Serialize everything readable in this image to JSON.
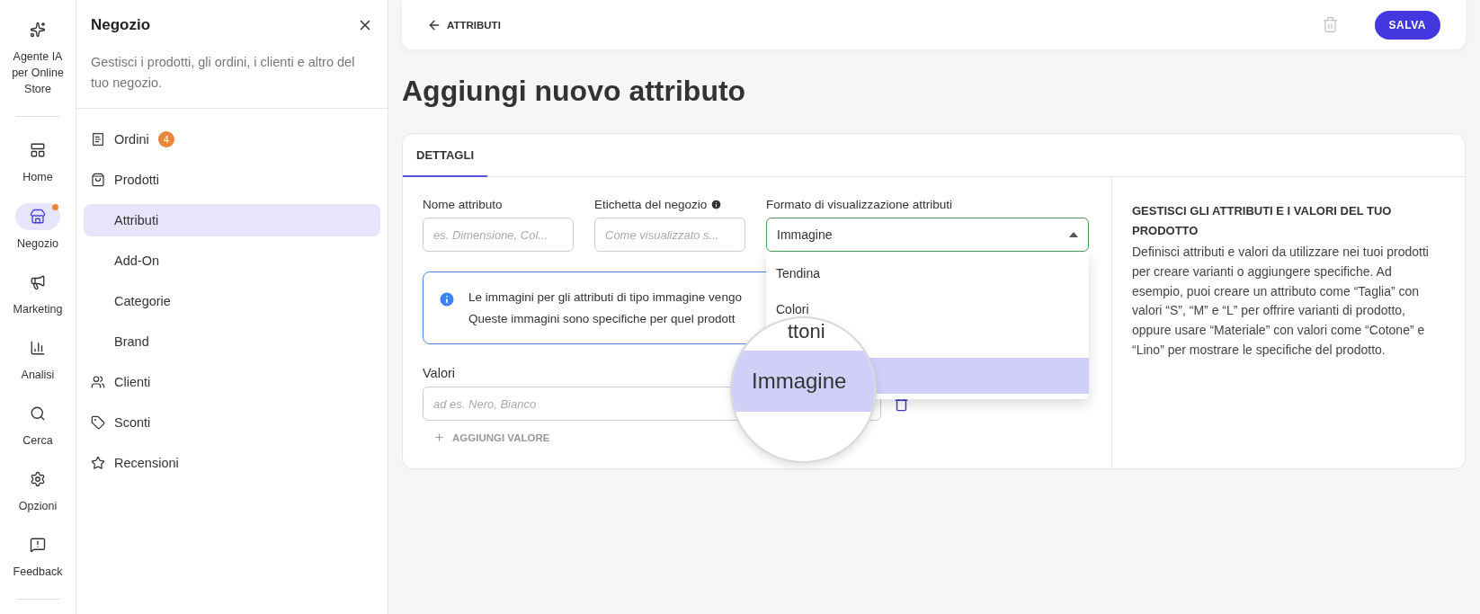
{
  "rail": {
    "items": [
      {
        "label": "Agente IA per Online Store",
        "kind": "assistant",
        "selected": false,
        "notification": false
      },
      {
        "label": "Home",
        "kind": "home",
        "selected": false,
        "notification": false
      },
      {
        "label": "Negozio",
        "kind": "store",
        "selected": true,
        "notification": true
      },
      {
        "label": "Marketing",
        "kind": "marketing",
        "selected": false,
        "notification": false
      },
      {
        "label": "Analisi",
        "kind": "analytics",
        "selected": false,
        "notification": false
      }
    ],
    "bottom_items": [
      {
        "label": "Cerca",
        "kind": "search",
        "selected": false,
        "notification": false
      },
      {
        "label": "Opzioni",
        "kind": "settings",
        "selected": false,
        "notification": false
      },
      {
        "label": "Feedback",
        "kind": "feedback",
        "selected": false,
        "notification": false
      }
    ]
  },
  "sidebar": {
    "title": "Negozio",
    "description": "Gestisci i prodotti, gli ordini, i clienti e altro del tuo negozio.",
    "items": [
      {
        "label": "Ordini",
        "kind": "orders",
        "badge": "4",
        "selected": false
      },
      {
        "label": "Prodotti",
        "kind": "products",
        "selected": false,
        "children": [
          {
            "label": "Attributi",
            "selected": true
          },
          {
            "label": "Add-On",
            "selected": false
          },
          {
            "label": "Categorie",
            "selected": false
          },
          {
            "label": "Brand",
            "selected": false
          }
        ]
      },
      {
        "label": "Clienti",
        "kind": "customers",
        "selected": false
      },
      {
        "label": "Sconti",
        "kind": "discounts",
        "selected": false
      },
      {
        "label": "Recensioni",
        "kind": "reviews",
        "selected": false
      }
    ]
  },
  "topbar": {
    "back": "ATTRIBUTI",
    "save": "SALVA"
  },
  "page": {
    "title": "Aggiungi nuovo attributo"
  },
  "card": {
    "tabs": [
      {
        "label": "DETTAGLI",
        "selected": true
      }
    ],
    "fields": [
      {
        "label": "Nome attributo",
        "info": false,
        "placeholder": "es. Dimensione, Col..."
      },
      {
        "label": "Etichetta del negozio",
        "info": true,
        "placeholder": "Come visualizzato s..."
      }
    ],
    "format": {
      "label": "Formato di visualizzazione attributi",
      "value": "Immagine",
      "expanded": true,
      "options": [
        {
          "label": "Tendina",
          "selected": false
        },
        {
          "label": "Colori",
          "selected": false
        },
        {
          "selected": true
        }
      ]
    },
    "notice": {
      "lines": [
        "Le immagini per gli attributi di tipo immagine vengo",
        "Queste immagini sono specifiche per quel prodott"
      ]
    },
    "values": {
      "label": "Valori",
      "placeholder": "ad es. Nero, Bianco",
      "add": "AGGIUNGI VALORE"
    },
    "help": {
      "title": "GESTISCI GLI ATTRIBUTI E I VALORI DEL TUO PRODOTTO",
      "text": "Definisci attributi e valori da utilizzare nei tuoi prodotti per creare varianti o aggiungere specifiche. Ad esempio, puoi creare un attributo come “Taglia” con valori “S”, “M” e “L” per offrire varianti di prodotto, oppure usare “Materiale” con valori come “Cotone” e “Lino” per mostrare le specifiche del prodotto."
    }
  },
  "magnifier": {
    "partial": "ttoni",
    "label": "Immagine"
  }
}
